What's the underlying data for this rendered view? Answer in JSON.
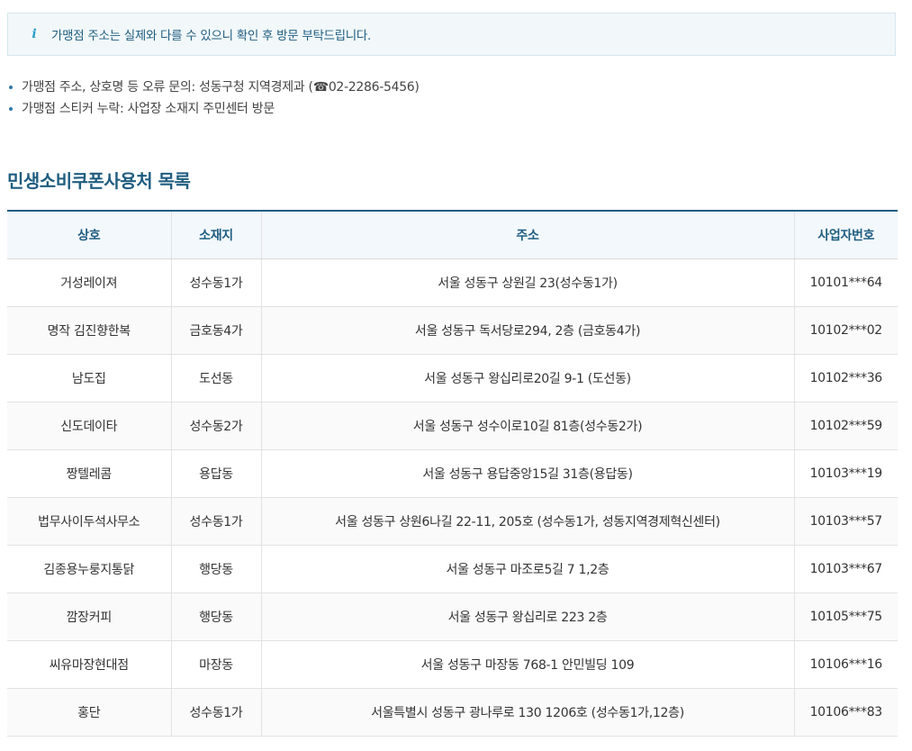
{
  "notice": {
    "icon": "info-icon",
    "text": "가맹점 주소는 실제와 다를 수 있으니 확인 후 방문 부탁드립니다."
  },
  "bullets": [
    "가맹점 주소, 상호명 등 오류 문의: 성동구청 지역경제과 (☎02-2286-5456)",
    "가맹점 스티커 누락: 사업장 소재지 주민센터 방문"
  ],
  "section_title": "민생소비쿠폰사용처 목록",
  "table": {
    "headers": [
      "상호",
      "소재지",
      "주소",
      "사업자번호"
    ],
    "rows": [
      [
        "거성레이져",
        "성수동1가",
        "서울 성동구 상원길 23(성수동1가)",
        "10101***64"
      ],
      [
        "명작 김진향한복",
        "금호동4가",
        "서울 성동구 독서당로294, 2층 (금호동4가)",
        "10102***02"
      ],
      [
        "남도집",
        "도선동",
        "서울 성동구 왕십리로20길 9-1 (도선동)",
        "10102***36"
      ],
      [
        "신도데이타",
        "성수동2가",
        "서울 성동구 성수이로10길 81층(성수동2가)",
        "10102***59"
      ],
      [
        "짱텔레콤",
        "용답동",
        "서울 성동구 용답중앙15길 31층(용답동)",
        "10103***19"
      ],
      [
        "법무사이두석사무소",
        "성수동1가",
        "서울 성동구 상원6나길 22-11, 205호 (성수동1가, 성동지역경제혁신센터)",
        "10103***57"
      ],
      [
        "김종용누룽지통닭",
        "행당동",
        "서울 성동구 마조로5길 7 1,2층",
        "10103***67"
      ],
      [
        "깜장커피",
        "행당동",
        "서울 성동구 왕십리로 223 2층",
        "10105***75"
      ],
      [
        "씨유마장현대점",
        "마장동",
        "서울 성동구 마장동 768-1 안민빌딩 109",
        "10106***16"
      ],
      [
        "홍단",
        "성수동1가",
        "서울특별시 성동구 광나루로 130 1206호 (성수동1가,12층)",
        "10106***83"
      ]
    ]
  }
}
